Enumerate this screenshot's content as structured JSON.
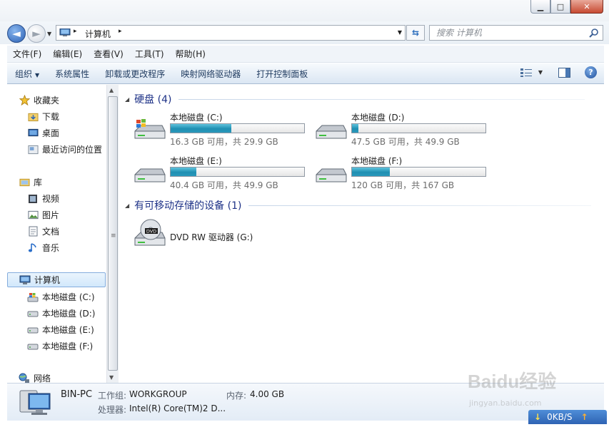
{
  "window": {
    "min_symbol": "▁",
    "max_symbol": "□",
    "close_symbol": "✕"
  },
  "address": {
    "crumb": "计算机",
    "back_symbol": "◄",
    "fwd_symbol": "►",
    "sep": "▸",
    "dropdown": "▼",
    "refresh_symbol": "⇆"
  },
  "search": {
    "placeholder": "搜索 计算机"
  },
  "menu": [
    "文件(F)",
    "编辑(E)",
    "查看(V)",
    "工具(T)",
    "帮助(H)"
  ],
  "toolbar": {
    "organize": "组织",
    "organize_arrow": "▼",
    "items": [
      "系统属性",
      "卸载或更改程序",
      "映射网络驱动器",
      "打开控制面板"
    ],
    "view_arrow": "▼",
    "help_symbol": "?"
  },
  "nav": {
    "favorites": "收藏夹",
    "downloads": "下载",
    "desktop": "桌面",
    "recent": "最近访问的位置",
    "libraries": "库",
    "videos": "视频",
    "pictures": "图片",
    "documents": "文档",
    "music": "音乐",
    "computer": "计算机",
    "drive_c": "本地磁盘 (C:)",
    "drive_d": "本地磁盘 (D:)",
    "drive_e": "本地磁盘 (E:)",
    "drive_f": "本地磁盘 (F:)",
    "network": "网络"
  },
  "scroll": {
    "up": "▲",
    "down": "▼",
    "grip": "≡"
  },
  "groups": {
    "hdd": "硬盘 (4)",
    "removable": "有可移动存储的设备 (1)",
    "triangle": "◢"
  },
  "drives": [
    {
      "name": "本地磁盘 (C:)",
      "size": "16.3 GB 可用，共 29.9 GB",
      "used_fraction": 0.455
    },
    {
      "name": "本地磁盘 (D:)",
      "size": "47.5 GB 可用，共 49.9 GB",
      "used_fraction": 0.048
    },
    {
      "name": "本地磁盘 (E:)",
      "size": "40.4 GB 可用，共 49.9 GB",
      "used_fraction": 0.19
    },
    {
      "name": "本地磁盘 (F:)",
      "size": "120 GB 可用，共 167 GB",
      "used_fraction": 0.281
    }
  ],
  "dvd": {
    "name": "DVD RW 驱动器 (G:)",
    "label": "DVD"
  },
  "details": {
    "pc_name": "BIN-PC",
    "workgroup_label": "工作组:",
    "workgroup": "WORKGROUP",
    "memory_label": "内存:",
    "memory": "4.00 GB",
    "cpu_label": "处理器:",
    "cpu": "Intel(R) Core(TM)2 D..."
  },
  "watermark": {
    "brand": "Baidu经验",
    "site": "jingyan.baidu.com"
  },
  "netspeed": {
    "down_arrow": "↓",
    "value": "0KB/S",
    "up_arrow": "↑"
  },
  "colors": {
    "accent": "#1e3287",
    "bar_fill": "#2a98bb",
    "selection": "#d2e8fb"
  }
}
